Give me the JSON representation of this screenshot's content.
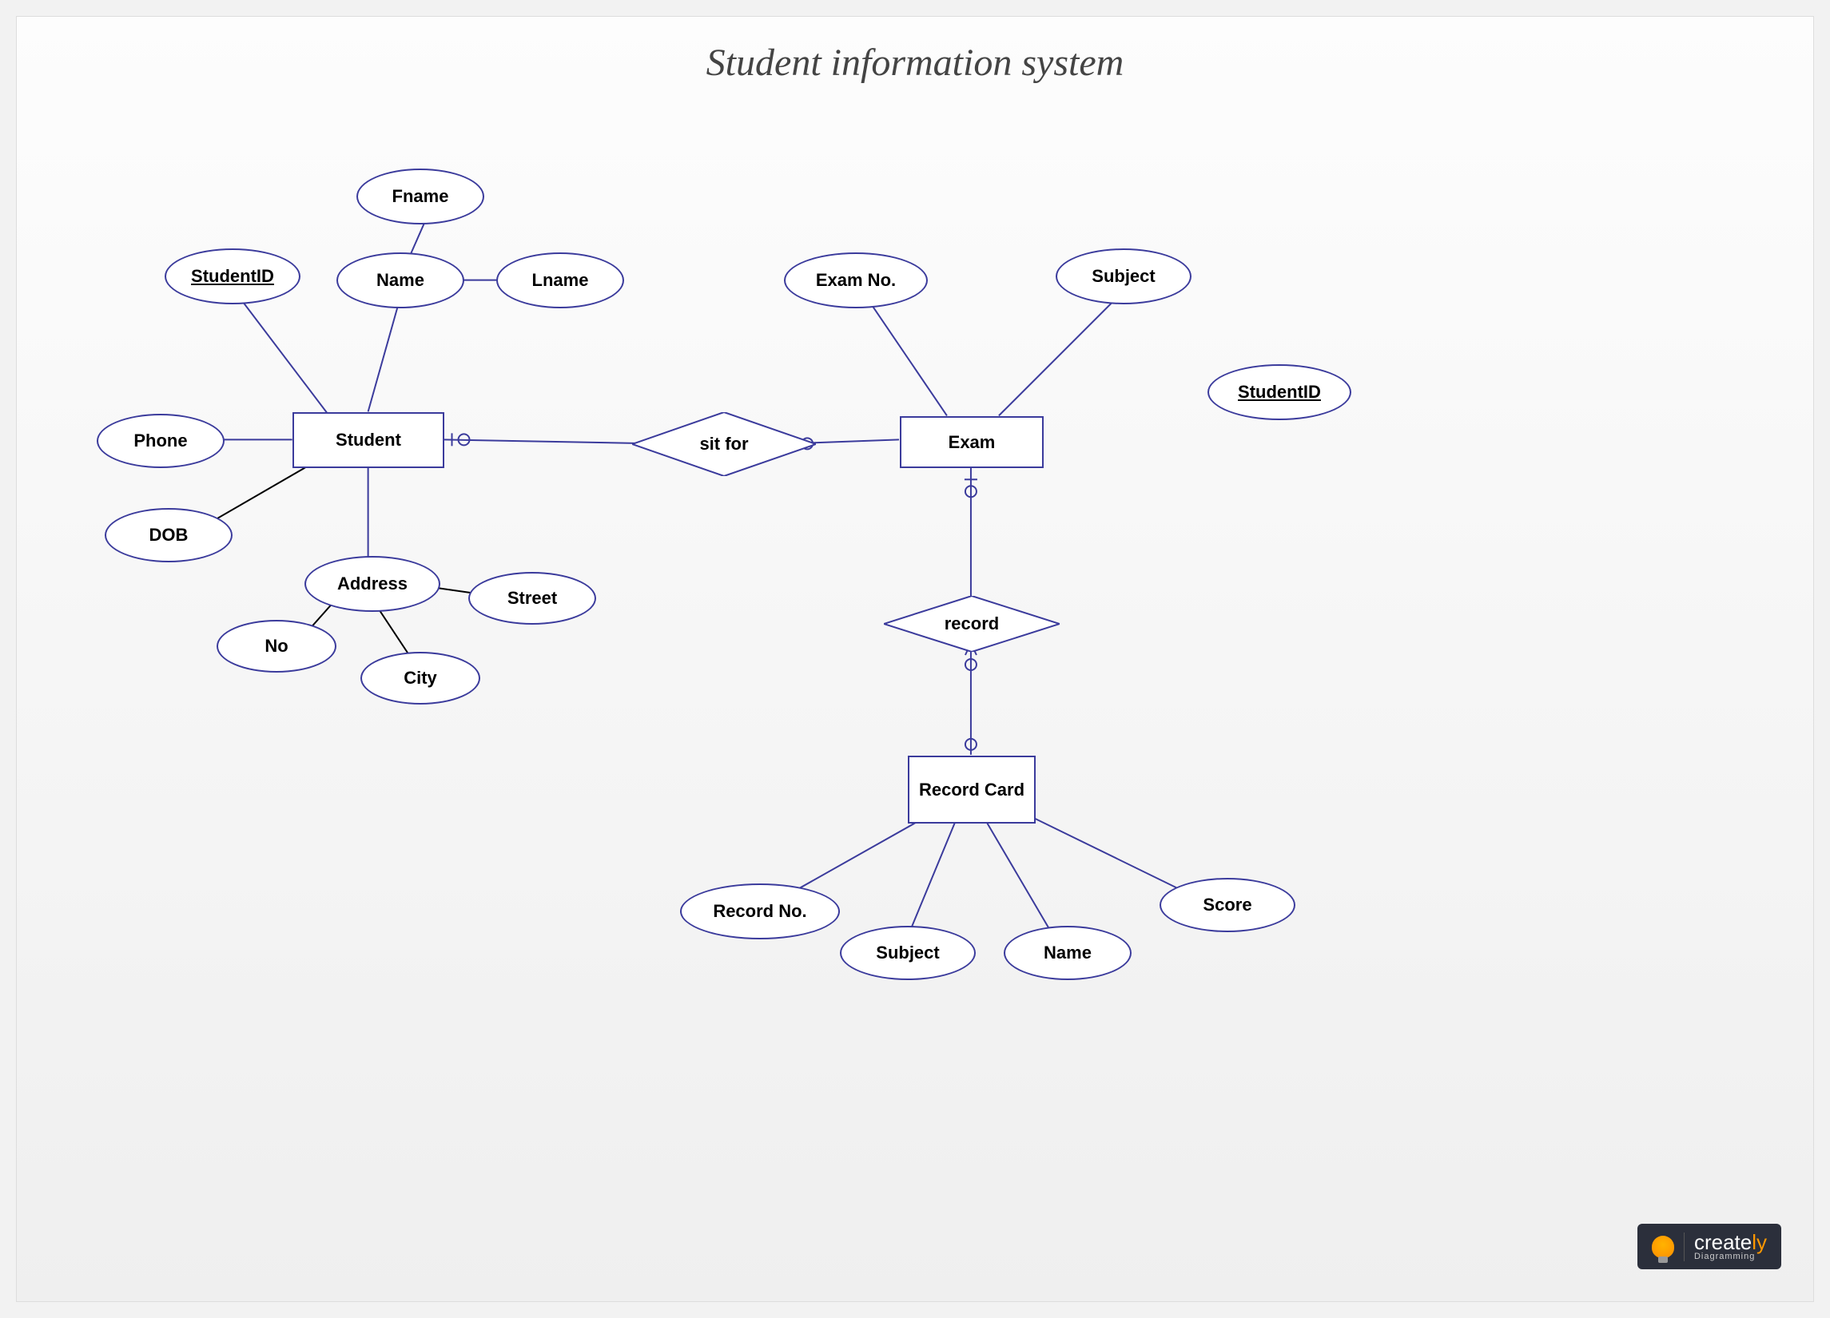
{
  "title": "Student information system",
  "entities": {
    "student": "Student",
    "exam": "Exam",
    "recordcard": "Record Card"
  },
  "relationships": {
    "sitfor": "sit for",
    "record": "record"
  },
  "attributes": {
    "student": {
      "studentid": "StudentID",
      "name": "Name",
      "fname": "Fname",
      "lname": "Lname",
      "phone": "Phone",
      "dob": "DOB",
      "address": "Address",
      "no": "No",
      "city": "City",
      "street": "Street"
    },
    "exam": {
      "examno": "Exam No.",
      "subject": "Subject",
      "studentid": "StudentID"
    },
    "recordcard": {
      "recordno": "Record No.",
      "subject": "Subject",
      "name": "Name",
      "score": "Score"
    }
  },
  "logo": {
    "brand_part1": "create",
    "brand_part2": "ly",
    "tagline": "Diagramming"
  }
}
